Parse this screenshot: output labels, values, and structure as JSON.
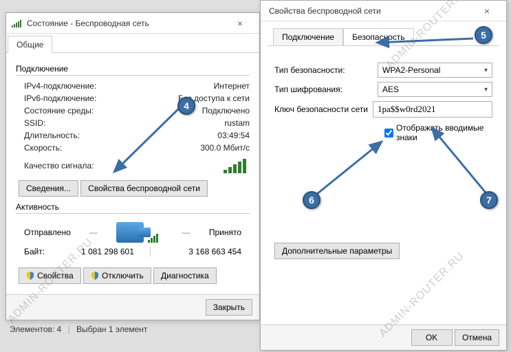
{
  "status_window": {
    "title": "Состояние - Беспроводная сеть",
    "tabs": {
      "general": "Общие"
    },
    "group_connection": "Подключение",
    "rows": {
      "ipv4_label": "IPv4-подключение:",
      "ipv4_value": "Интернет",
      "ipv6_label": "IPv6-подключение:",
      "ipv6_value": "Без доступа к сети",
      "media_label": "Состояние среды:",
      "media_value": "Подключено",
      "ssid_label": "SSID:",
      "ssid_value": "rustam",
      "duration_label": "Длительность:",
      "duration_value": "03:49:54",
      "speed_label": "Скорость:",
      "speed_value": "300.0 Мбит/с",
      "signal_label": "Качество сигнала:"
    },
    "buttons": {
      "details": "Сведения...",
      "wireless_props": "Свойства беспроводной сети"
    },
    "group_activity": "Активность",
    "activity": {
      "sent_label": "Отправлено",
      "recv_label": "Принято",
      "bytes_label": "Байт:",
      "sent_bytes": "1 081 298 601",
      "recv_bytes": "3 168 663 454"
    },
    "action_buttons": {
      "properties": "Свойства",
      "disable": "Отключить",
      "diagnose": "Диагностика"
    },
    "close": "Закрыть"
  },
  "status_strip": {
    "elements": "Элементов: 4",
    "selected": "Выбран 1 элемент"
  },
  "props_window": {
    "title": "Свойства беспроводной сети",
    "tabs": {
      "connection": "Подключение",
      "security": "Безопасность"
    },
    "security": {
      "type_label": "Тип безопасности:",
      "type_value": "WPA2-Personal",
      "enc_label": "Тип шифрования:",
      "enc_value": "AES",
      "key_label": "Ключ безопасности сети",
      "key_value": "1pa$$w0rd2021",
      "show_chars": "Отображать вводимые знаки",
      "advanced": "Дополнительные параметры"
    },
    "ok": "OK",
    "cancel": "Отмена"
  },
  "markers": {
    "m4": "4",
    "m5": "5",
    "m6": "6",
    "m7": "7"
  },
  "watermark": "ADMIN-ROUTER.RU"
}
